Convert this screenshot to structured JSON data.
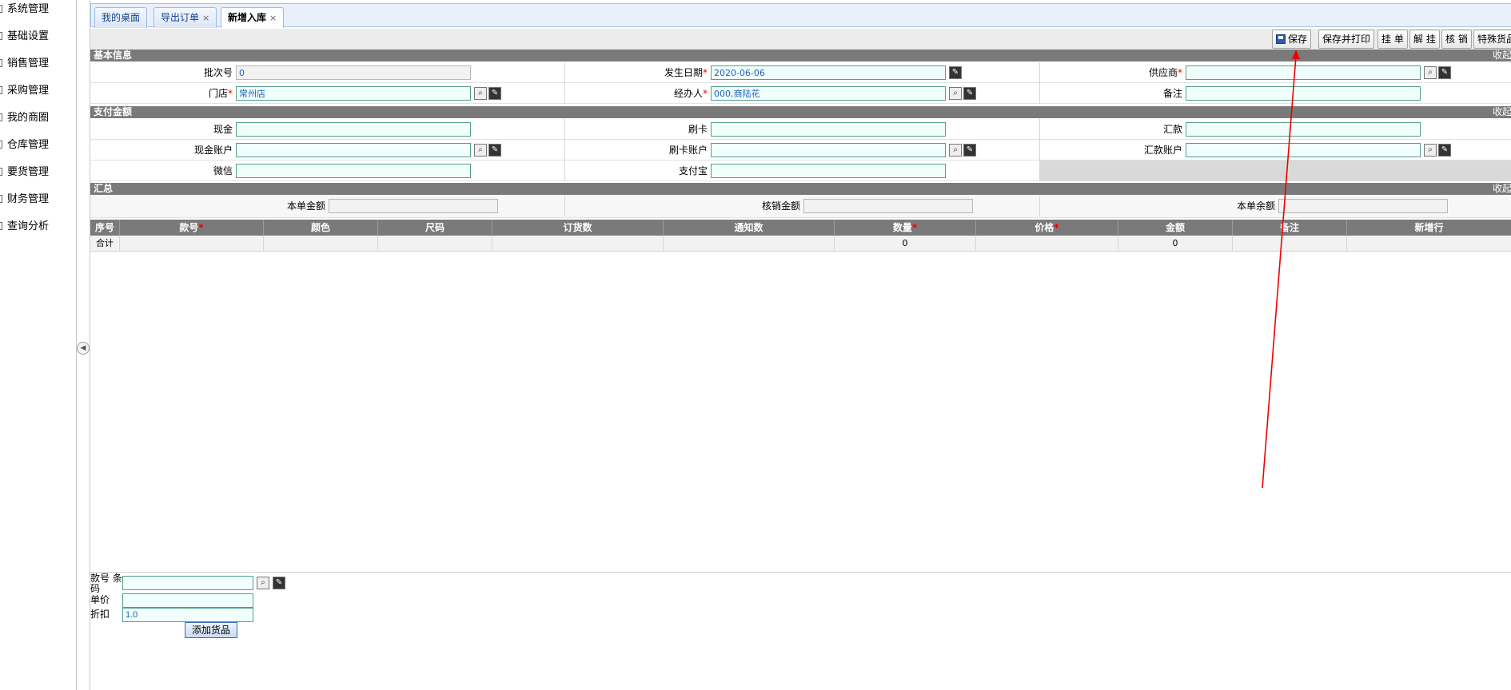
{
  "sidebar": {
    "items": [
      {
        "label": "系统管理"
      },
      {
        "label": "基础设置"
      },
      {
        "label": "销售管理"
      },
      {
        "label": "采购管理"
      },
      {
        "label": "我的商圈"
      },
      {
        "label": "仓库管理"
      },
      {
        "label": "要货管理"
      },
      {
        "label": "财务管理"
      },
      {
        "label": "查询分析"
      }
    ]
  },
  "tabs": [
    {
      "label": "我的桌面",
      "closable": false,
      "active": false
    },
    {
      "label": "导出订单",
      "closable": true,
      "active": false
    },
    {
      "label": "新增入库",
      "closable": true,
      "active": true
    }
  ],
  "tab_close_glyph": "×",
  "toolbar": {
    "save": "保存",
    "save_print": "保存并打印",
    "hang": "挂 单",
    "unhang": "解 挂",
    "verify": "核 销",
    "special": "特殊货品"
  },
  "sections": {
    "basic": {
      "title": "基本信息",
      "collapse": "收起"
    },
    "payment": {
      "title": "支付金额",
      "collapse": "收起"
    },
    "summary": {
      "title": "汇总",
      "collapse": "收起"
    }
  },
  "basic": {
    "batch_no": {
      "label": "批次号",
      "value": "0"
    },
    "date": {
      "label": "发生日期",
      "required": "*",
      "value": "2020-06-06"
    },
    "supplier": {
      "label": "供应商",
      "required": "*",
      "value": ""
    },
    "store": {
      "label": "门店",
      "required": "*",
      "value": "常州店"
    },
    "handler": {
      "label": "经办人",
      "required": "*",
      "value": "000,商陆花"
    },
    "remark": {
      "label": "备注",
      "value": ""
    }
  },
  "payment": {
    "cash": {
      "label": "现金",
      "value": ""
    },
    "card": {
      "label": "刷卡",
      "value": ""
    },
    "remit": {
      "label": "汇款",
      "value": ""
    },
    "cash_account": {
      "label": "现金账户",
      "value": ""
    },
    "card_account": {
      "label": "刷卡账户",
      "value": ""
    },
    "remit_account": {
      "label": "汇款账户",
      "value": ""
    },
    "wechat": {
      "label": "微信",
      "value": ""
    },
    "alipay": {
      "label": "支付宝",
      "value": ""
    }
  },
  "summary": {
    "this_amount": {
      "label": "本单金额",
      "value": ""
    },
    "writeoff_amount": {
      "label": "核销金额",
      "value": ""
    },
    "this_balance": {
      "label": "本单余额",
      "value": ""
    }
  },
  "grid": {
    "columns": [
      "序号",
      "款号",
      "颜色",
      "尺码",
      "订货数",
      "通知数",
      "数量",
      "价格",
      "金额",
      "备注",
      "新增行"
    ],
    "sum_row": {
      "label": "合计",
      "quantity": "0",
      "amount": "0"
    }
  },
  "quick_add": {
    "code_label": "款号 条码",
    "code_value": "",
    "price_label": "单价",
    "price_value": "",
    "discount_label": "折扣",
    "discount_value": "1.0",
    "add_button": "添加货品"
  },
  "colors": {
    "accent": "#15428b",
    "required": "#ee0000",
    "annotation_arrow": "#ee0000"
  }
}
